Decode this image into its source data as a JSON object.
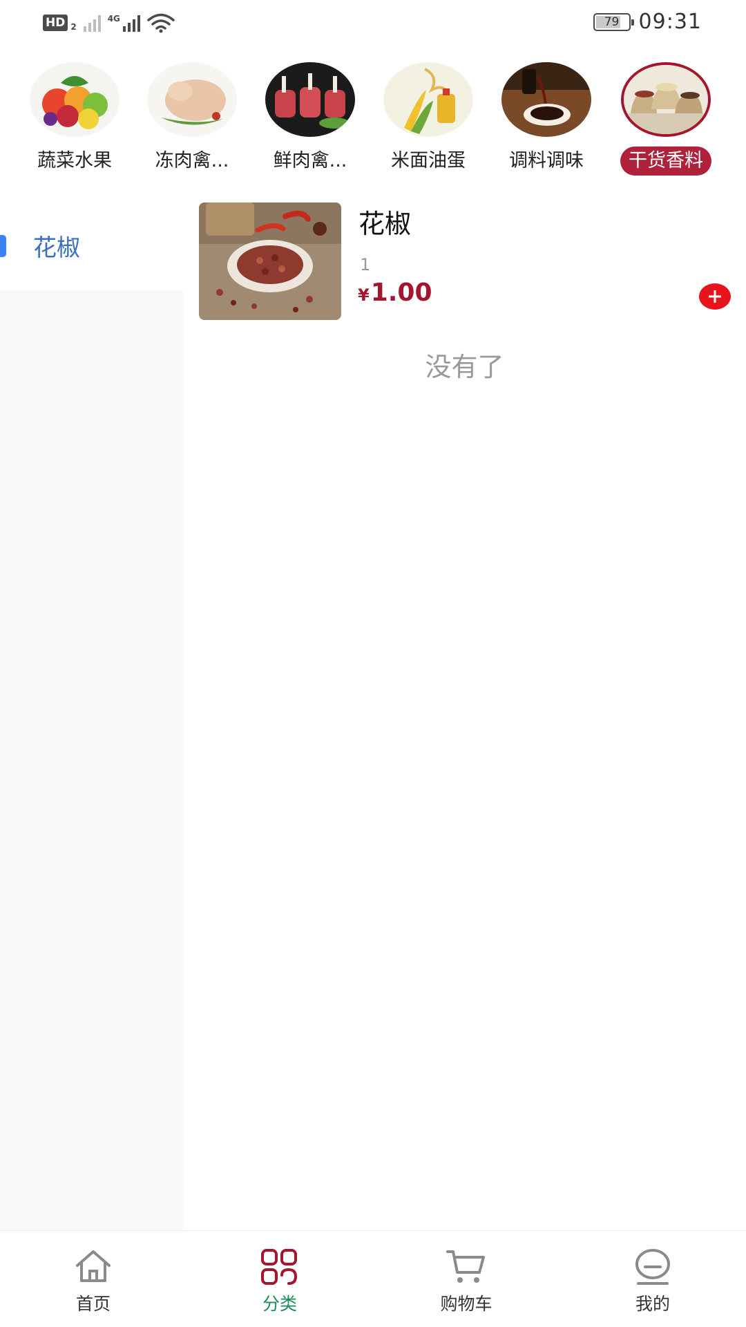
{
  "status_bar": {
    "hd_label": "HD",
    "sim_number": "2",
    "network_type": "4G",
    "battery_percent": "79",
    "battery_level": 0.79,
    "time": "09:31",
    "icons": [
      "hd-icon",
      "signal-icon",
      "signal-icon",
      "wifi-icon",
      "battery-icon"
    ]
  },
  "categories": [
    {
      "label": "蔬菜水果",
      "image": "vegetables-fruit-image",
      "active": false
    },
    {
      "label": "冻肉禽...",
      "image": "frozen-poultry-image",
      "active": false
    },
    {
      "label": "鲜肉禽...",
      "image": "fresh-meat-image",
      "active": false
    },
    {
      "label": "米面油蛋",
      "image": "rice-oil-image",
      "active": false
    },
    {
      "label": "调料调味",
      "image": "sauce-image",
      "active": false
    },
    {
      "label": "干货香料",
      "image": "dry-goods-image",
      "active": true
    }
  ],
  "side_nav": {
    "items": [
      {
        "label": "花椒",
        "active": true
      }
    ]
  },
  "products": [
    {
      "name": "花椒",
      "subtitle": "1",
      "currency": "¥",
      "price": "1.00",
      "image": "sichuan-pepper-image",
      "add_icon": "plus-icon"
    }
  ],
  "list_end_text": "没有了",
  "tab_bar": {
    "tabs": [
      {
        "label": "首页",
        "icon": "home-icon",
        "active": false
      },
      {
        "label": "分类",
        "icon": "category-icon",
        "active": true
      },
      {
        "label": "购物车",
        "icon": "cart-icon",
        "active": false
      },
      {
        "label": "我的",
        "icon": "profile-icon",
        "active": false
      }
    ]
  },
  "colors": {
    "accent": "#a3162e",
    "active_tab": "#1d8a5a",
    "side_active": "#3b6fc4",
    "side_indicator": "#3b82f6",
    "add_button": "#e8141b"
  }
}
